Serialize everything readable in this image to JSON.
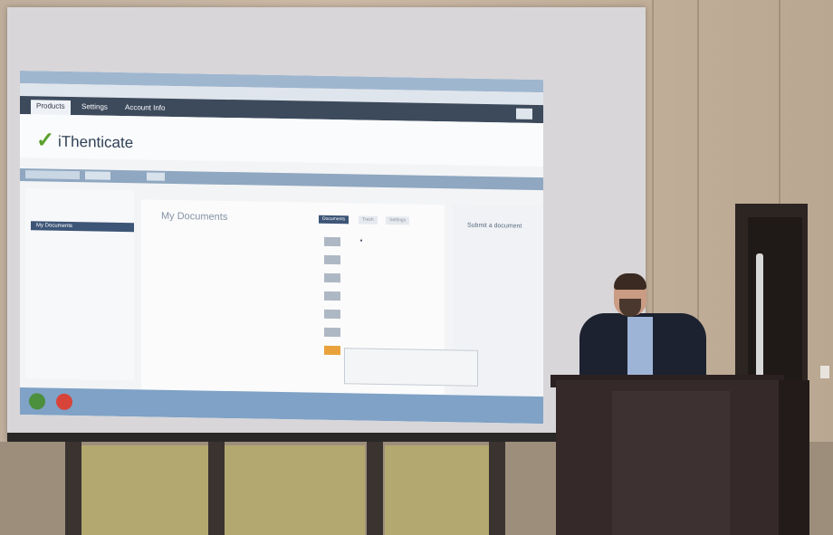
{
  "presentation": {
    "browser": {
      "nav_tabs": [
        "Products",
        "Settings",
        "Account Info"
      ],
      "logo_text": "iThenticate"
    },
    "documents_panel": {
      "title": "My Documents",
      "folder_selected": "My Documents",
      "view_tabs": [
        "Documents",
        "Trash",
        "Settings"
      ]
    },
    "right_panel": {
      "submit_title": "Submit a document"
    }
  },
  "colors": {
    "accent": "#3d5576",
    "logo_check": "#5aa02c"
  },
  "icons": [
    "checkmark-icon",
    "start-menu-icon",
    "chrome-icon"
  ]
}
